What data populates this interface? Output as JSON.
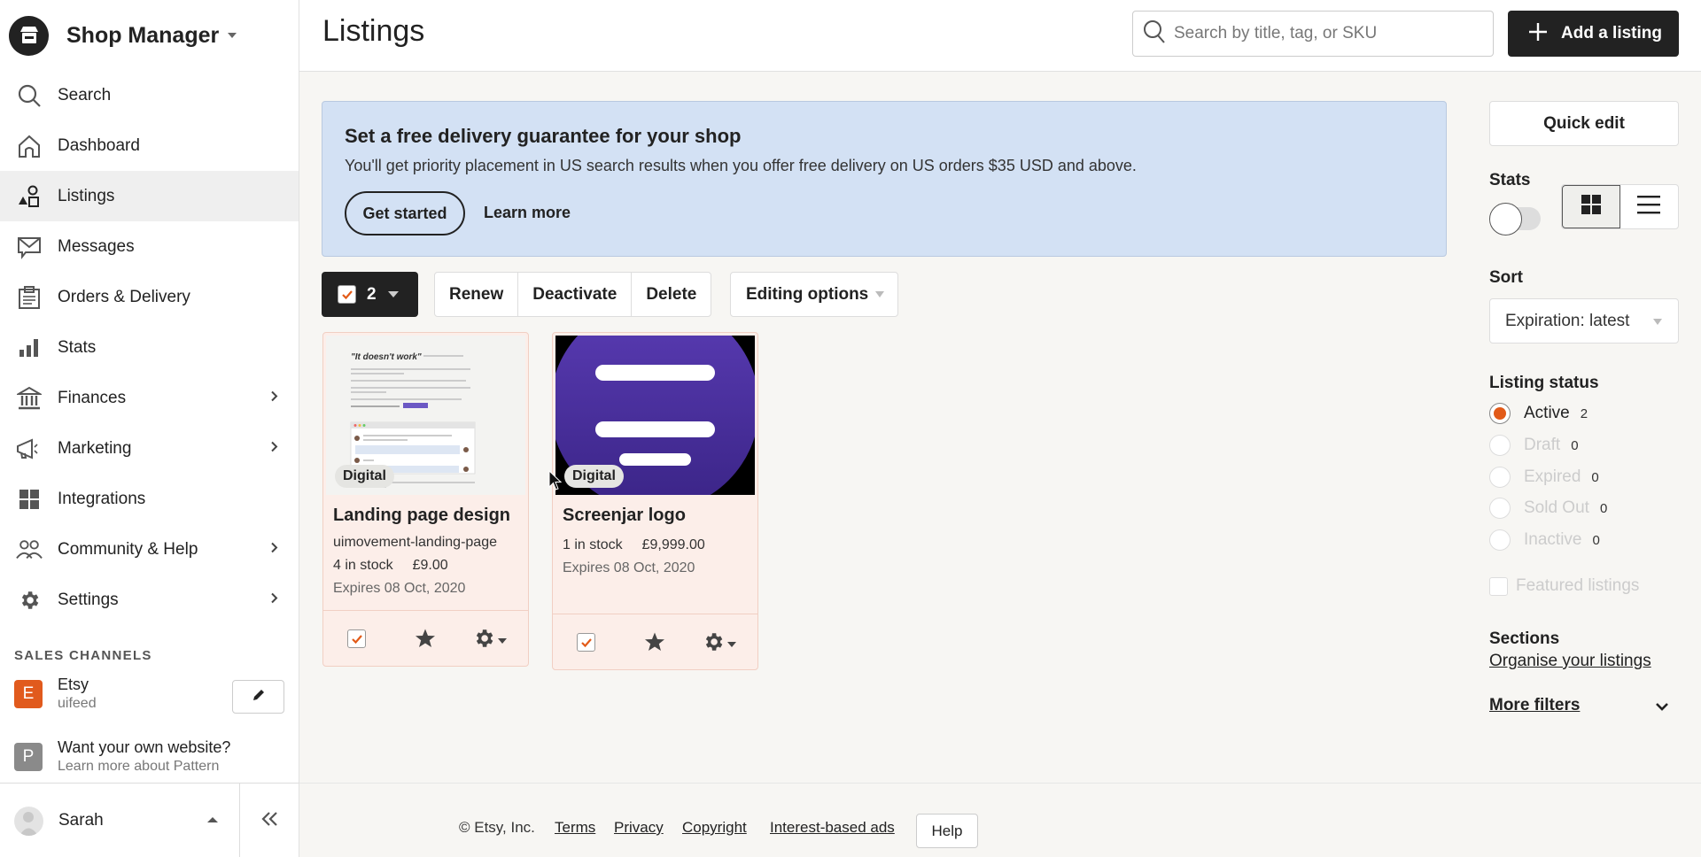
{
  "brand": {
    "title": "Shop Manager"
  },
  "nav": {
    "items": [
      {
        "label": "Search",
        "icon": "search-icon"
      },
      {
        "label": "Dashboard",
        "icon": "home-icon"
      },
      {
        "label": "Listings",
        "icon": "shapes-icon",
        "active": true
      },
      {
        "label": "Messages",
        "icon": "envelope-icon"
      },
      {
        "label": "Orders & Delivery",
        "icon": "clipboard-icon"
      },
      {
        "label": "Stats",
        "icon": "bar-chart-icon"
      },
      {
        "label": "Finances",
        "icon": "bank-icon",
        "has_submenu": true
      },
      {
        "label": "Marketing",
        "icon": "megaphone-icon",
        "has_submenu": true
      },
      {
        "label": "Integrations",
        "icon": "grid-icon"
      },
      {
        "label": "Community & Help",
        "icon": "people-icon",
        "has_submenu": true
      },
      {
        "label": "Settings",
        "icon": "gear-icon",
        "has_submenu": true
      }
    ]
  },
  "sales_channels": {
    "title": "SALES CHANNELS",
    "etsy": {
      "badge": "E",
      "name": "Etsy",
      "sub": "uifeed",
      "color": "#e15a1d"
    },
    "pattern": {
      "badge": "P",
      "name": "Want your own website?",
      "sub": "Learn more about Pattern",
      "color": "#8a8a8a"
    }
  },
  "user": {
    "name": "Sarah"
  },
  "header": {
    "title": "Listings",
    "search_placeholder": "Search by title, tag, or SKU",
    "search_value": "",
    "add_label": "Add a listing"
  },
  "banner": {
    "title": "Set a free delivery guarantee for your shop",
    "text": "You'll get priority placement in US search results when you offer free delivery on US orders $35 USD and above.",
    "primary": "Get started",
    "secondary": "Learn more"
  },
  "toolbar": {
    "selected_count": "2",
    "renew": "Renew",
    "deactivate": "Deactivate",
    "delete": "Delete",
    "editing_options": "Editing options"
  },
  "listings": [
    {
      "tag": "Digital",
      "title": "Landing page design",
      "sku": "uimovement-landing-page",
      "stock": "4 in stock",
      "price": "£9.00",
      "expires": "Expires 08 Oct, 2020",
      "selected": true,
      "thumb_heading": "\"It doesn't work\""
    },
    {
      "tag": "Digital",
      "title": "Screenjar logo",
      "sku": "",
      "stock": "1 in stock",
      "price": "£9,999.00",
      "expires": "Expires 08 Oct, 2020",
      "selected": true
    }
  ],
  "right_panel": {
    "quick_edit": "Quick edit",
    "stats_label": "Stats",
    "stats_on": false,
    "view_mode": "grid",
    "sort_label": "Sort",
    "sort_value": "Expiration: latest",
    "status_label": "Listing status",
    "statuses": [
      {
        "label": "Active",
        "count": "2",
        "checked": true
      },
      {
        "label": "Draft",
        "count": "0"
      },
      {
        "label": "Expired",
        "count": "0"
      },
      {
        "label": "Sold Out",
        "count": "0"
      },
      {
        "label": "Inactive",
        "count": "0"
      }
    ],
    "featured_label": "Featured listings",
    "sections_label": "Sections",
    "organise_link": "Organise your listings",
    "more_filters": "More filters"
  },
  "footer": {
    "copyright": "© Etsy, Inc.",
    "links": [
      "Terms",
      "Privacy",
      "Copyright",
      "Interest-based ads"
    ],
    "help": "Help"
  },
  "colors": {
    "accent": "#e25a18",
    "banner_bg": "#d3e1f4",
    "card_bg": "#fceee9",
    "dark": "#222222"
  }
}
